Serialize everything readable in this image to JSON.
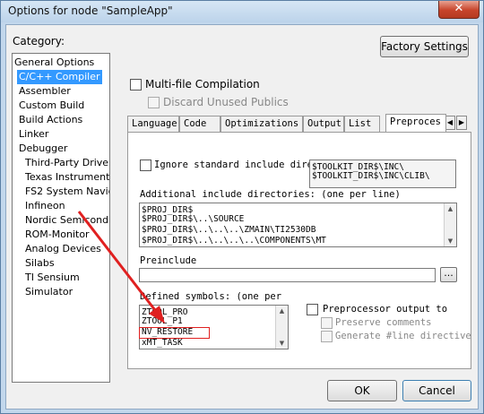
{
  "window": {
    "title": "Options for node \"SampleApp\"",
    "close_glyph": "✕"
  },
  "category": {
    "label": "Category:",
    "items": [
      "General Options",
      "C/C++ Compiler",
      "Assembler",
      "Custom Build",
      "Build Actions",
      "Linker",
      "Debugger",
      "Third-Party Driver",
      "Texas Instruments",
      "FS2 System Navig",
      "Infineon",
      "Nordic Semiconduc",
      "ROM-Monitor",
      "Analog Devices",
      "Silabs",
      "TI Sensium",
      "Simulator"
    ],
    "selected": "C/C++ Compiler"
  },
  "buttons": {
    "factory_settings": "Factory Settings",
    "ok": "OK",
    "cancel": "Cancel",
    "browse": "..."
  },
  "options": {
    "multi_file": "Multi-file Compilation",
    "discard_unused": "Discard Unused Publics"
  },
  "tabs": {
    "items": [
      "Language",
      "Code",
      "Optimizations",
      "Output",
      "List",
      "Preproces"
    ],
    "active": "Preproces",
    "scroll_left": "◀",
    "scroll_right": "▶"
  },
  "preprocessor": {
    "ignore_std_include": "Ignore standard include dire",
    "std_include_dirs": [
      "$TOOLKIT_DIR$\\INC\\",
      "$TOOLKIT_DIR$\\INC\\CLIB\\"
    ],
    "additional_include_label": "Additional include directories: (one per line)",
    "additional_include_dirs": [
      "$PROJ_DIR$",
      "$PROJ_DIR$\\..\\SOURCE",
      "$PROJ_DIR$\\..\\..\\..\\ZMAIN\\TI2530DB",
      "$PROJ_DIR$\\..\\..\\..\\..\\COMPONENTS\\MT"
    ],
    "preinclude_label": "Preinclude",
    "preinclude_value": "",
    "defined_symbols_label": "Defined symbols: (one per",
    "defined_symbols": [
      "ZTOOL_PRO",
      "ZTOOL_P1",
      "NV_RESTORE",
      "xMT_TASK"
    ],
    "preprocessor_output": "Preprocessor output to",
    "preserve_comments": "Preserve comments",
    "generate_line": "Generate #line directive"
  },
  "colors": {
    "selection": "#3399ff",
    "annotation": "#e02020"
  }
}
